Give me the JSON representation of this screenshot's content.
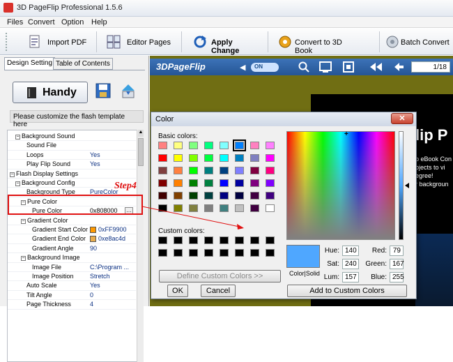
{
  "app": {
    "title": "3D PageFlip Professional 1.5.6"
  },
  "menu": [
    {
      "label": "Files"
    },
    {
      "label": "Convert"
    },
    {
      "label": "Option"
    },
    {
      "label": "Help"
    }
  ],
  "toolbar": {
    "import_pdf": "Import PDF",
    "editor_pages": "Editor Pages",
    "apply_change": "Apply Change",
    "convert_3d": "Convert to 3D Book",
    "batch_convert": "Batch Convert"
  },
  "tabs": [
    {
      "label": "Design Setting"
    },
    {
      "label": "Table of Contents"
    }
  ],
  "template": {
    "name": "Handy",
    "hint": "Please customize the flash template here"
  },
  "properties": [
    {
      "label": "Background Sound",
      "value": "",
      "indent": 1,
      "group": true
    },
    {
      "label": "Sound File",
      "value": "",
      "indent": 3,
      "group": false
    },
    {
      "label": "Loops",
      "value": "Yes",
      "indent": 3,
      "group": false
    },
    {
      "label": "Play Flip Sound",
      "value": "Yes",
      "indent": 3,
      "group": false
    },
    {
      "label": "Flash Display Settings",
      "value": "",
      "indent": 0,
      "group": true
    },
    {
      "label": "Background Config",
      "value": "",
      "indent": 1,
      "group": true
    },
    {
      "label": "Background Type",
      "value": "PureColor",
      "indent": 3,
      "group": false
    },
    {
      "label": "Pure Color",
      "value": "",
      "indent": 2,
      "group": true
    },
    {
      "label": "Pure Color",
      "value": "0x808000",
      "indent": 4,
      "group": false
    },
    {
      "label": "Gradient Color",
      "value": "",
      "indent": 2,
      "group": true
    },
    {
      "label": "Gradient Start Color",
      "value": "0xFF9900",
      "indent": 4,
      "group": false
    },
    {
      "label": "Gradient End Color",
      "value": "0xe8ac4d",
      "indent": 4,
      "group": false
    },
    {
      "label": "Gradient Angle",
      "value": "90",
      "indent": 4,
      "group": false
    },
    {
      "label": "Background Image",
      "value": "",
      "indent": 2,
      "group": true
    },
    {
      "label": "Image File",
      "value": "C:\\Program ...",
      "indent": 4,
      "group": false
    },
    {
      "label": "Image Position",
      "value": "Stretch",
      "indent": 4,
      "group": false
    },
    {
      "label": "Auto Scale",
      "value": "Yes",
      "indent": 3,
      "group": false
    },
    {
      "label": "Tilt Angle",
      "value": "0",
      "indent": 3,
      "group": false
    },
    {
      "label": "Page Thickness",
      "value": "4",
      "indent": 3,
      "group": false
    }
  ],
  "annotation": {
    "label": "Step4"
  },
  "viewer": {
    "brand": "3DPageFlip",
    "toggle": "ON",
    "page": "1/18",
    "book_title": "lip P",
    "book_lines": [
      "p eBook Con",
      "bjects to vi",
      "egree!",
      "r backgroun"
    ]
  },
  "color_dialog": {
    "title": "Color",
    "basic_label": "Basic colors:",
    "custom_label": "Custom colors:",
    "define_btn": "Define Custom Colors >>",
    "ok": "OK",
    "cancel": "Cancel",
    "add_btn": "Add to Custom Colors",
    "color_solid": "Color|Solid",
    "hue_label": "Hue:",
    "hue": "140",
    "sat_label": "Sat:",
    "sat": "240",
    "lum_label": "Lum:",
    "lum": "157",
    "red_label": "Red:",
    "red": "79",
    "green_label": "Green:",
    "green": "167",
    "blue_label": "Blue:",
    "blue": "255",
    "basic_colors": [
      "#ff8080",
      "#ffff80",
      "#80ff80",
      "#00ff80",
      "#80ffff",
      "#0080ff",
      "#ff80c0",
      "#ff80ff",
      "#ff0000",
      "#ffff00",
      "#80ff00",
      "#00ff40",
      "#00ffff",
      "#0080c0",
      "#8080c0",
      "#ff00ff",
      "#804040",
      "#ff8040",
      "#00ff00",
      "#008080",
      "#004080",
      "#8080ff",
      "#800040",
      "#ff0080",
      "#800000",
      "#ff8000",
      "#008000",
      "#008040",
      "#0000ff",
      "#0000a0",
      "#800080",
      "#8000ff",
      "#400000",
      "#804000",
      "#004000",
      "#004040",
      "#000080",
      "#000040",
      "#400040",
      "#400080",
      "#000000",
      "#808000",
      "#808040",
      "#808080",
      "#408080",
      "#c0c0c0",
      "#400040",
      "#ffffff"
    ],
    "selected_index": 5,
    "custom_colors": [
      "#000000",
      "#000000",
      "#000000",
      "#000000",
      "#000000",
      "#000000",
      "#000000",
      "#000000",
      "#000000",
      "#000000",
      "#000000",
      "#000000",
      "#000000",
      "#000000",
      "#000000",
      "#000000"
    ],
    "current_color": "#4fa7ff"
  }
}
